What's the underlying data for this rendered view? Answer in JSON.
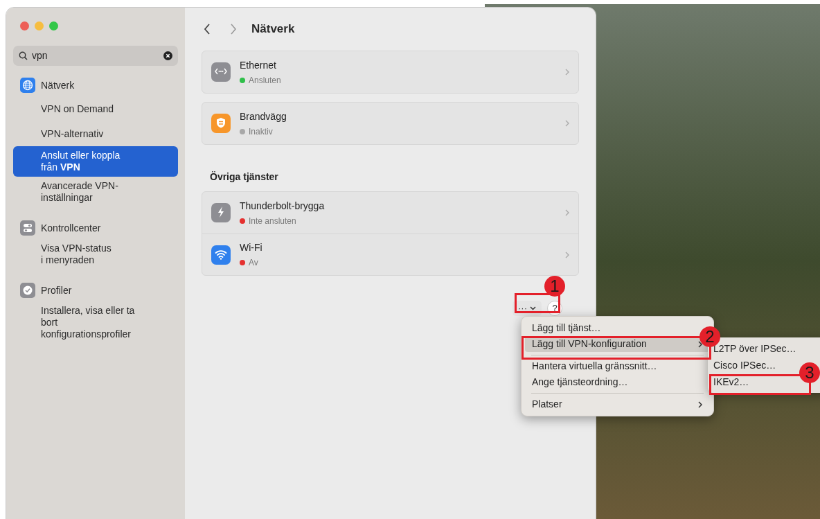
{
  "search": {
    "value": "vpn"
  },
  "sidebar": {
    "groups": [
      {
        "label": "Nätverk",
        "kind": "globe",
        "items": [
          {
            "label": "VPN on Demand",
            "selected": false
          },
          {
            "label": "VPN-alternativ",
            "selected": false
          },
          {
            "label": "Anslut eller koppla\nfrån **VPN**",
            "selected": true
          },
          {
            "label": "Avancerade VPN-\ninställningar",
            "selected": false
          }
        ]
      },
      {
        "label": "Kontrollcenter",
        "kind": "toggles",
        "items": [
          {
            "label": "Visa VPN-status\ni menyraden",
            "selected": false
          }
        ]
      },
      {
        "label": "Profiler",
        "kind": "badge",
        "items": [
          {
            "label": "Installera, visa eller ta\nbort\nkonfigurationsprofiler",
            "selected": false
          }
        ]
      }
    ]
  },
  "header": {
    "title": "Nätverk"
  },
  "services": [
    {
      "items": [
        {
          "kind": "ethernet",
          "name": "Ethernet",
          "status": "Ansluten",
          "color": "#2fbf4a"
        }
      ]
    },
    {
      "items": [
        {
          "kind": "firewall",
          "name": "Brandvägg",
          "status": "Inaktiv",
          "color": "#a8a8a8"
        }
      ]
    },
    {
      "heading": "Övriga tjänster",
      "items": [
        {
          "kind": "thunderbolt",
          "name": "Thunderbolt-brygga",
          "status": "Inte ansluten",
          "color": "#e5302f"
        },
        {
          "kind": "wifi",
          "name": "Wi-Fi",
          "status": "Av",
          "color": "#e5302f"
        }
      ]
    }
  ],
  "more_button": {
    "label": "···"
  },
  "help_button": {
    "label": "?"
  },
  "menu": {
    "groups": [
      [
        {
          "label": "Lägg till tjänst…",
          "submenu": false,
          "selected": false
        },
        {
          "label": "Lägg till VPN-konfiguration",
          "submenu": true,
          "selected": true
        }
      ],
      [
        {
          "label": "Hantera virtuella gränssnitt…",
          "submenu": false,
          "selected": false
        },
        {
          "label": "Ange tjänsteordning…",
          "submenu": false,
          "selected": false
        }
      ],
      [
        {
          "label": "Platser",
          "submenu": true,
          "selected": false
        }
      ]
    ]
  },
  "submenu": {
    "items": [
      {
        "label": "L2TP över IPSec…"
      },
      {
        "label": "Cisco IPSec…"
      },
      {
        "label": "IKEv2…"
      }
    ]
  },
  "annotations": [
    {
      "label": "1"
    },
    {
      "label": "2"
    },
    {
      "label": "3"
    }
  ]
}
